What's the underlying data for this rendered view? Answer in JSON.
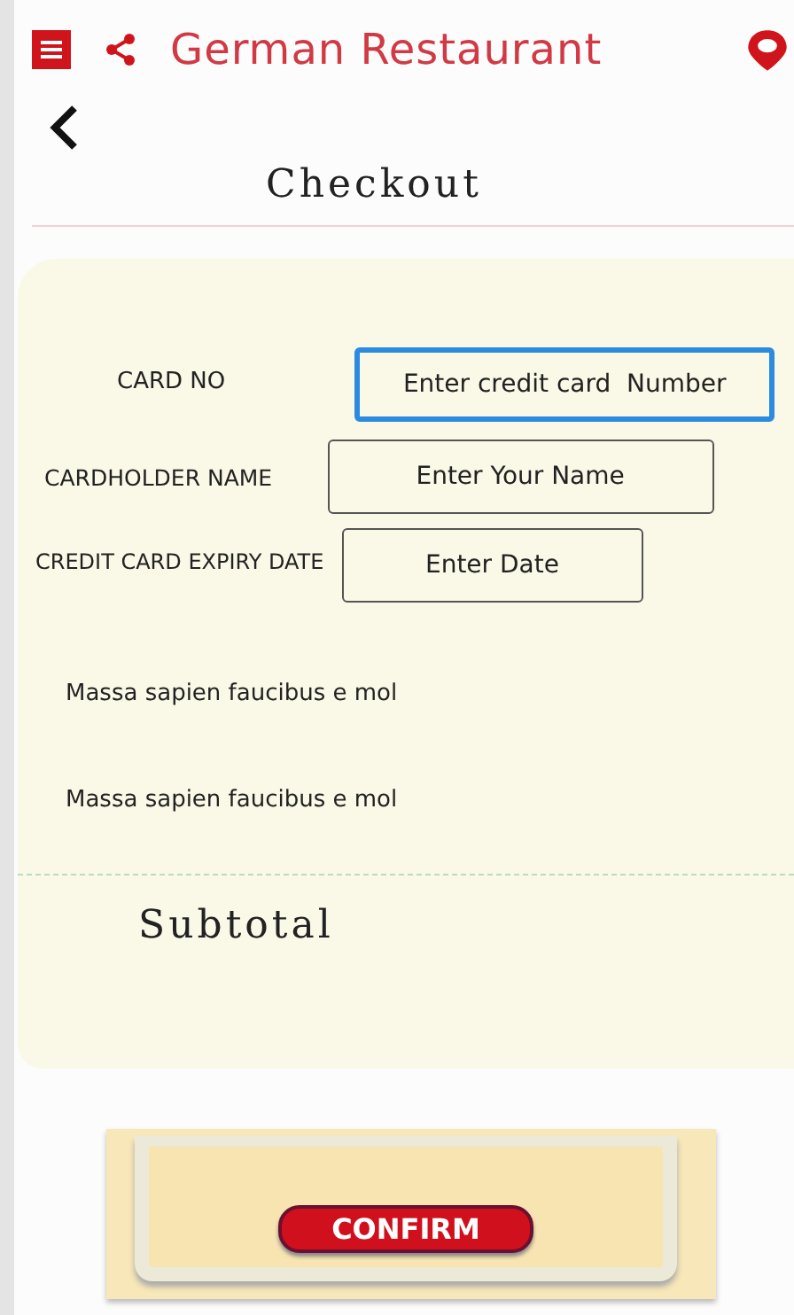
{
  "header": {
    "title": "German Restaurant"
  },
  "page": {
    "title": "Checkout"
  },
  "form": {
    "fields": [
      {
        "label": "CARD NO",
        "placeholder": "Enter credit card  Number",
        "focused": true
      },
      {
        "label": "CARDHOLDER NAME",
        "placeholder": "Enter Your Name",
        "focused": false
      },
      {
        "label": "CREDIT CARD EXPIRY DATE",
        "placeholder": "Enter Date",
        "focused": false
      }
    ],
    "notes": [
      "Massa sapien faucibus e mol",
      "Massa sapien faucibus e mol"
    ],
    "subtotal": "Subtotal"
  },
  "confirm_button": "CONFIRM"
}
